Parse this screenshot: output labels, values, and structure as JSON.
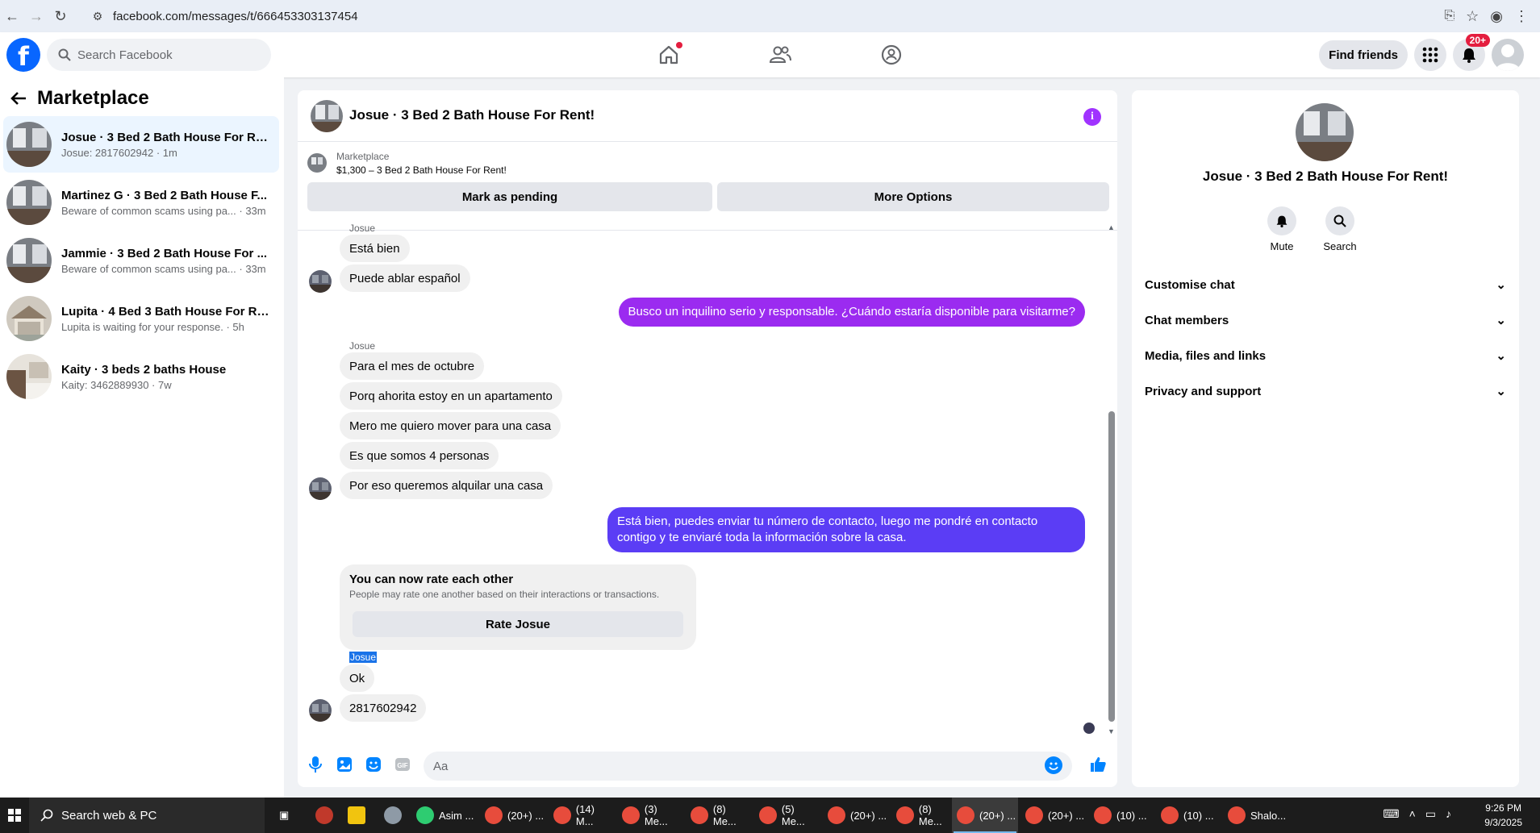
{
  "browser": {
    "url": "facebook.com/messages/t/666453303137454"
  },
  "header": {
    "search_placeholder": "Search Facebook",
    "find_friends": "Find friends",
    "notification_badge": "20+"
  },
  "sidebar": {
    "title": "Marketplace",
    "conversations": [
      {
        "title": "Josue · 3 Bed 2 Bath House For Re...",
        "subtitle": "Josue: 2817602942 · 1m"
      },
      {
        "title": "Martinez G · 3 Bed 2 Bath House F...",
        "subtitle": "Beware of common scams using pa... · 33m"
      },
      {
        "title": "Jammie · 3 Bed 2 Bath House For ...",
        "subtitle": "Beware of common scams using pa... · 33m"
      },
      {
        "title": "Lupita · 4 Bed 3 Bath House For Re...",
        "subtitle": "Lupita is waiting for your response. · 5h"
      },
      {
        "title": "Kaity · 3 beds 2 baths House",
        "subtitle": "Kaity: 3462889930 · 7w"
      }
    ]
  },
  "chat": {
    "title": "Josue · 3 Bed 2 Bath House For Rent!",
    "marketplace_label": "Marketplace",
    "listing": "$1,300 – 3 Bed 2 Bath House For Rent!",
    "mark_pending": "Mark as pending",
    "more_options": "More Options",
    "sender_1": "Josue",
    "msg_1": "Está bien",
    "msg_2": "Puede ablar español",
    "out_1": "Busco un inquilino serio y responsable. ¿Cuándo estaría disponible para visitarme?",
    "sender_2": "Josue",
    "msg_3": "Para el mes de octubre",
    "msg_4": "Porq ahorita estoy en un apartamento",
    "msg_5": "Mero me quiero mover para una casa",
    "msg_6": "Es que somos 4 personas",
    "msg_7": "Por eso queremos alquilar una casa",
    "out_2": "Está bien, puedes enviar tu número de contacto, luego me pondré en contacto contigo y te enviaré toda la información sobre la casa.",
    "sender_3": "Josue",
    "msg_8": "Ok",
    "rate_title": "You can now rate each other",
    "rate_desc": "People may rate one another based on their interactions or transactions.",
    "rate_button": "Rate Josue",
    "msg_9": "2817602942",
    "composer_placeholder": "Aa",
    "colors": {
      "out_1": "#9b2bf0",
      "out_2": "#5b3df5",
      "accent": "#0084ff"
    }
  },
  "details": {
    "title": "Josue · 3 Bed 2 Bath House For Rent!",
    "mute": "Mute",
    "search": "Search",
    "sections": [
      "Customise chat",
      "Chat members",
      "Media, files and links",
      "Privacy and support"
    ]
  },
  "taskbar": {
    "search": "Search web & PC",
    "items": [
      "Asim ...",
      "(20+) ...",
      "(14) M...",
      "(3) Me...",
      "(8) Me...",
      "(5) Me...",
      "(20+) ...",
      "(8) Me...",
      "(20+) ...",
      "(20+) ...",
      "(10) ...",
      "(10) ...",
      "Shalo..."
    ],
    "time": "9:26 PM",
    "date": "9/3/2025"
  }
}
